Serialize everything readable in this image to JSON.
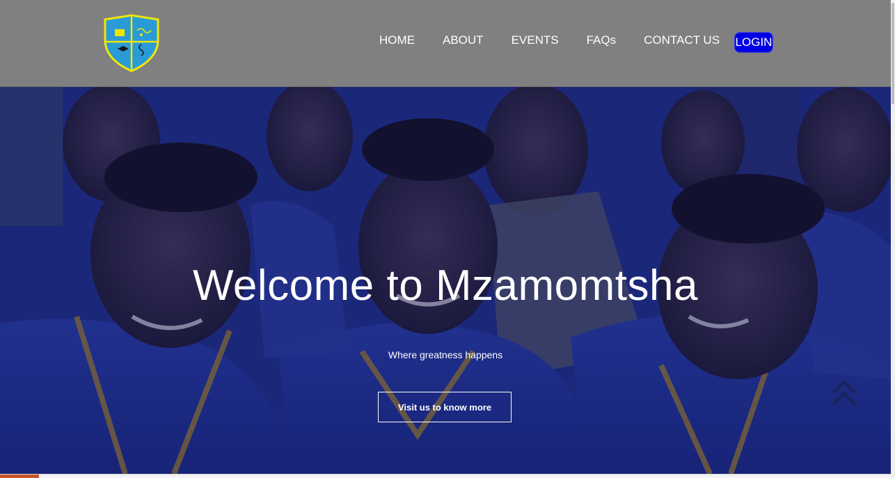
{
  "header": {
    "logo_icon": "school-crest-icon",
    "nav": {
      "home": "HOME",
      "about": "ABOUT",
      "events": "EVENTS",
      "faqs": "FAQs",
      "contact": "CONTACT US"
    },
    "login_label": "LOGIN"
  },
  "hero": {
    "title": "Welcome to Mzamomtsha",
    "subtitle": "Where greatness happens",
    "cta_label": "Visit us to know more",
    "scroll_top_icon": "double-chevron-up-icon",
    "background": "photo of smiling schoolchildren in blue uniforms"
  },
  "colors": {
    "header_bg": "#808080",
    "login_bg": "#0000e6",
    "hero_overlay": "#1a2890",
    "crest_outline": "#f2e600",
    "crest_fill": "#2a9bd6"
  }
}
